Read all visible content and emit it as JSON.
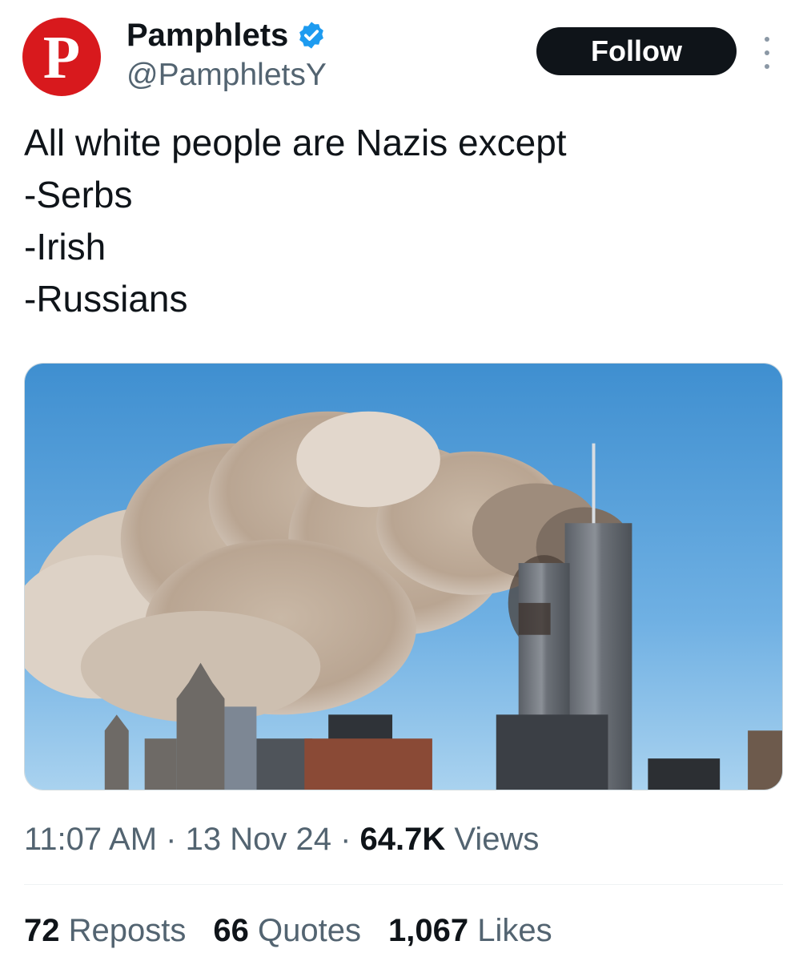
{
  "author": {
    "avatar_letter": "P",
    "display_name": "Pamphlets",
    "handle": "@PamphletsY",
    "verified": true
  },
  "follow_button": {
    "label": "Follow"
  },
  "tweet": {
    "lines": [
      "All white people are Nazis except",
      "-Serbs",
      "-Irish",
      "-Russians"
    ]
  },
  "meta": {
    "time": "11:07 AM",
    "separator": "·",
    "date": "13 Nov 24",
    "views_count": "64.7K",
    "views_label": "Views"
  },
  "stats": {
    "reposts_count": "72",
    "reposts_label": "Reposts",
    "quotes_count": "66",
    "quotes_label": "Quotes",
    "likes_count": "1,067",
    "likes_label": "Likes"
  },
  "colors": {
    "avatar_bg": "#d8191d",
    "verified_blue": "#1d9bf0",
    "button_bg": "#0f1419",
    "secondary_text": "#536471"
  },
  "icons": [
    "verified-badge-icon",
    "more-options-icon"
  ]
}
